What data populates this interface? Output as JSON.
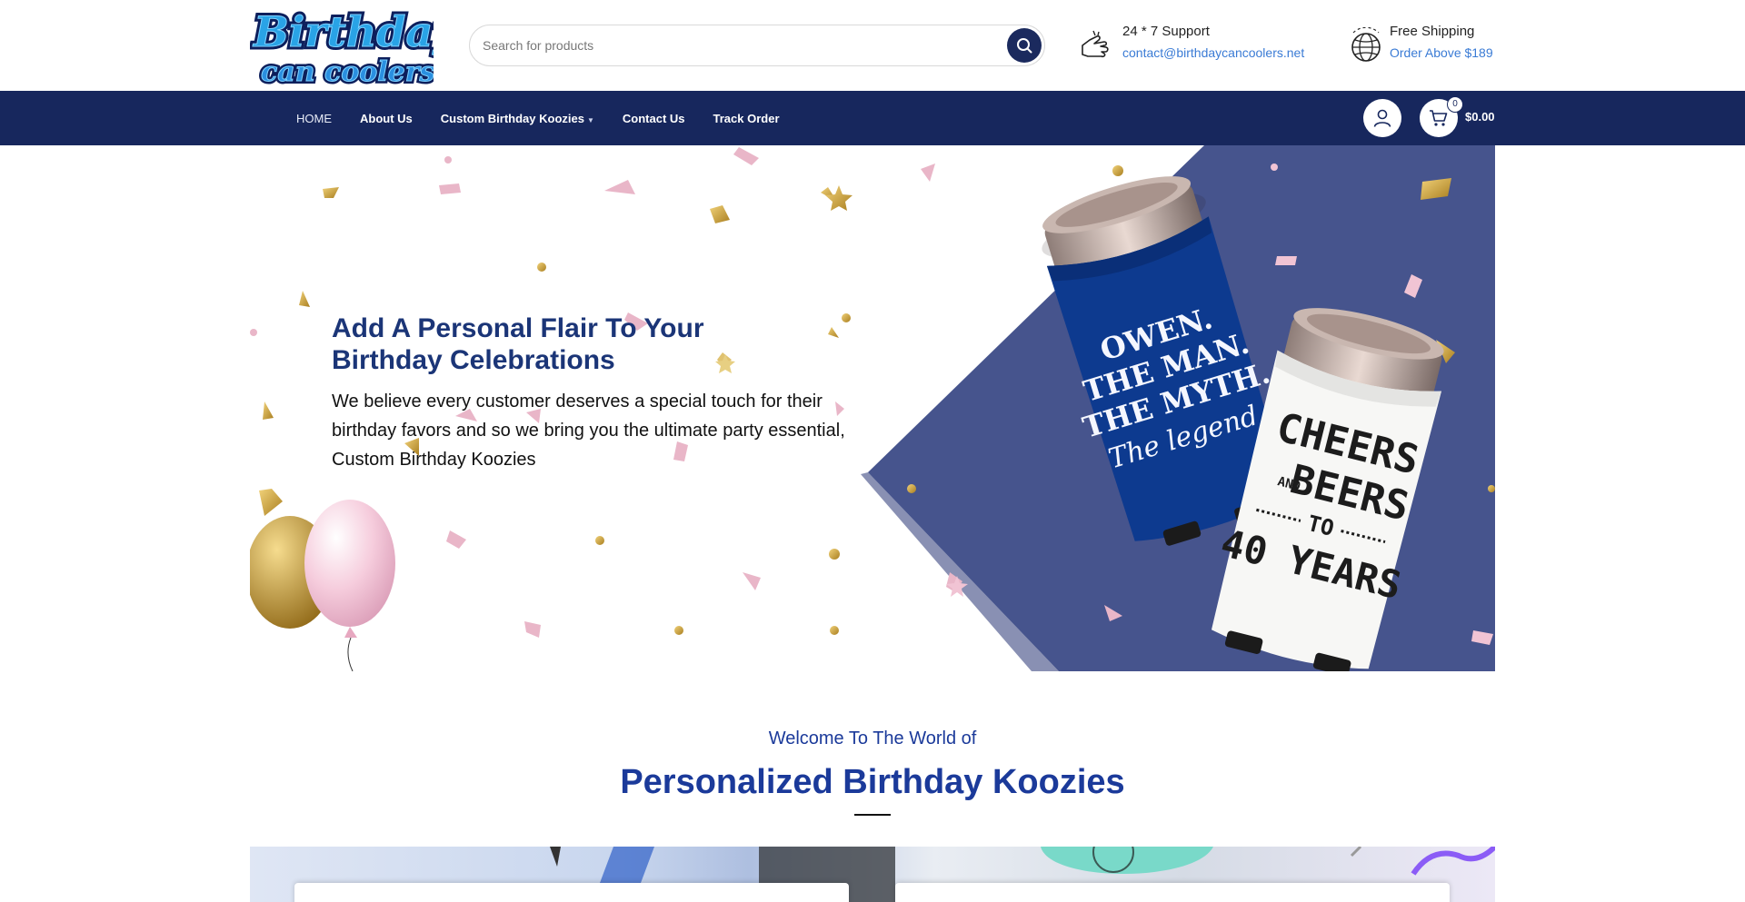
{
  "brand": {
    "logo_line1": "Birthday",
    "logo_line2": "can coolers"
  },
  "search": {
    "placeholder": "Search for products",
    "icon": "search-icon"
  },
  "support": {
    "title": "24 * 7 Support",
    "email": "contact@birthdaycancoolers.net",
    "icon": "support-hand-icon"
  },
  "shipping": {
    "title": "Free Shipping",
    "note": "Order Above $189",
    "icon": "globe-icon"
  },
  "nav": {
    "items": [
      {
        "label": "HOME"
      },
      {
        "label": "About Us"
      },
      {
        "label": "Custom Birthday Koozies"
      },
      {
        "label": "Contact Us"
      },
      {
        "label": "Track Order"
      }
    ],
    "cart_count": "0",
    "cart_total": "$0.00"
  },
  "hero": {
    "heading": "Add A Personal Flair To Your Birthday Celebrations",
    "text": "We believe every customer deserves a special touch for their birthday favors and so we bring you the ultimate party essential, Custom Birthday Koozies",
    "koozie_blue_lines": [
      "OWEN.",
      "THE MAN.",
      "THE MYTH.",
      "The legend."
    ],
    "koozie_white_lines": [
      "CHEERS",
      "AND",
      "BEERS",
      "TO",
      "40 YEARS"
    ]
  },
  "welcome": {
    "subtitle": "Welcome To The World of",
    "title": "Personalized Birthday Koozies"
  },
  "colors": {
    "navy": "#17275d",
    "heading_blue": "#1b3577",
    "link_blue": "#3a7bd5",
    "accent_blue": "#1b3a9a",
    "panel_blue": "#46548d"
  }
}
